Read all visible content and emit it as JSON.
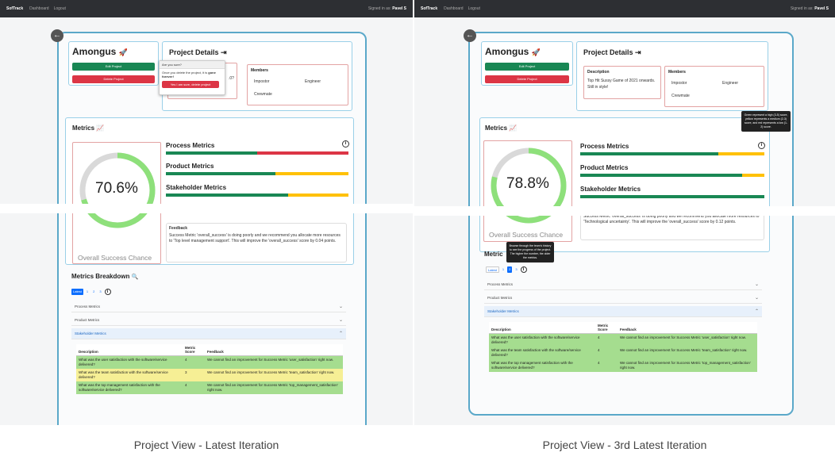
{
  "nav": {
    "brand": "SofTrack",
    "links": [
      "Dashboard",
      "Logout"
    ],
    "signed_in": "Signed in as:",
    "user": "Pavel S"
  },
  "project": {
    "name": "Amongus",
    "edit_label": "Edit Project",
    "delete_label": "Delete Project"
  },
  "details": {
    "title": "Project Details",
    "desc_label": "Description",
    "desc_text": "Top Hit Sussy Game of 2021 onwards. Still in style!",
    "members_label": "Members",
    "members": [
      "Impostor",
      "Engineer",
      "Crewmate"
    ]
  },
  "confirm": {
    "title": "Are you sure?",
    "text_prefix": "Once you delete the project, it is",
    "text_bold": "gone forever!",
    "action": "Yes I am sure, delete project"
  },
  "metrics": {
    "title": "Metrics",
    "names": [
      "Process Metrics",
      "Product Metrics",
      "Stakeholder Metrics"
    ],
    "success_label": "Overall Success Chance",
    "feedback_label": "Feedback"
  },
  "left": {
    "score": "70.6%",
    "score_fraction": 0.706,
    "feedback": "Success Metric 'overall_success' is doing poorly and we recommend you allocate more resources to 'Top level management support'. This will improve the 'overall_success' score by 0.04 points."
  },
  "right": {
    "score": "78.8%",
    "score_fraction": 0.788,
    "feedback_fragment": "Success Metric 'overall_success' is doing poorly and we recommend you allocate more resources to 'Technological uncertainty'. This will improve the 'overall_success' score by 0.12 points."
  },
  "breakdown": {
    "title": "Metrics Breakdown",
    "pages": [
      "Latest",
      "1",
      "2",
      "3"
    ],
    "sections": [
      "Process Metrics",
      "Product Metrics",
      "Stakeholder Metrics"
    ],
    "headers": [
      "Description",
      "Metric Score",
      "Feedback"
    ],
    "rows": [
      {
        "desc": "What was the user satisfaction with the software/service delivered?",
        "fb": "We cannot find an improvement for Success Metric 'user_satisfaction' right now."
      },
      {
        "desc": "What was the team satisfaction with the software/service delivered?",
        "fb": "We cannot find an improvement for Success Metric 'team_satisfaction' right now."
      },
      {
        "desc": "What was the top management satisfaction with the software/service delivered?",
        "fb": "We cannot find an improvement for Success Metric 'top_management_satisfaction' right now."
      }
    ],
    "left_scores": [
      "4",
      "3",
      "4"
    ],
    "right_scores": [
      "4",
      "4",
      "4"
    ]
  },
  "tooltips": {
    "metric_legend": "Green represent a high (3-5) score, yellow represents a medium (2-3) score, and red represents a low (1-2) score.",
    "pagination": "Browse through the team's history to see the progress of the project. The higher the number, the older the metrics."
  },
  "captions": {
    "left": "Project View - Latest Iteration",
    "right": "Project View - 3rd Latest Iteration"
  },
  "colors": {
    "green": "#198754",
    "red": "#dc3545",
    "yellow": "#ffc107",
    "gauge_green": "#8ee07b",
    "gauge_grey": "#d9d9d9"
  }
}
